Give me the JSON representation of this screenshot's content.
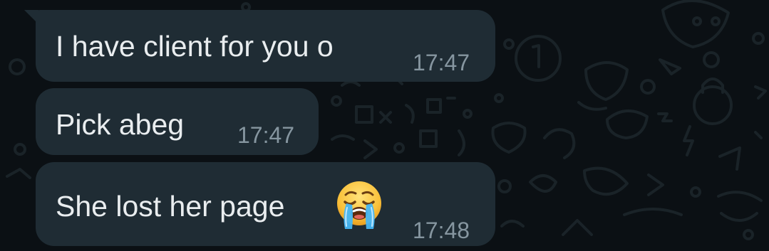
{
  "messages": [
    {
      "text": "I have client for you o",
      "time": "17:47"
    },
    {
      "text": "Pick abeg",
      "time": "17:47"
    },
    {
      "text": "She lost her page",
      "time": "17:48",
      "emoji": "loudly-crying-face-icon"
    }
  ],
  "colors": {
    "background": "#0b1014",
    "bubble": "#1f2c34",
    "text": "#e9edef",
    "timestamp": "#8696a0",
    "wallpaper_doodle": "#1a2328"
  }
}
